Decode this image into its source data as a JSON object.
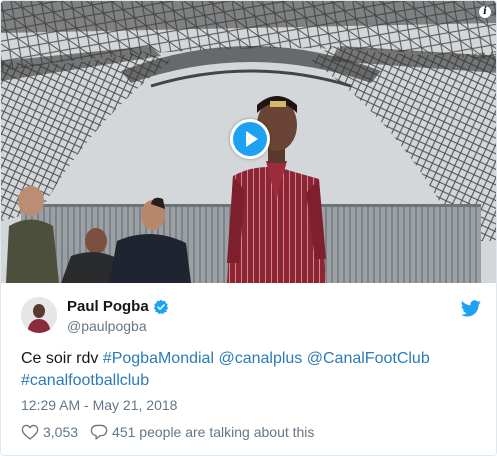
{
  "media": {
    "info_glyph": "i",
    "play_icon": "play-icon",
    "accent_color": "#1da1f2"
  },
  "author": {
    "display_name": "Paul Pogba",
    "handle": "@paulpogba",
    "verified_icon": "verified-badge-icon",
    "platform_icon": "twitter-bird-icon"
  },
  "tweet": {
    "text_parts": [
      {
        "type": "text",
        "value": "Ce soir rdv "
      },
      {
        "type": "link",
        "value": "#PogbaMondial"
      },
      {
        "type": "text",
        "value": " "
      },
      {
        "type": "link",
        "value": "@canalplus"
      },
      {
        "type": "text",
        "value": " "
      },
      {
        "type": "link",
        "value": "@CanalFootClub"
      },
      {
        "type": "text",
        "value": " "
      },
      {
        "type": "link",
        "value": "#canalfootballclub"
      }
    ],
    "timestamp": "12:29 AM - May 21, 2018",
    "link_color": "#2b7bb9"
  },
  "actions": {
    "likes": "3,053",
    "talking": "451 people are talking about this",
    "like_icon": "heart-icon",
    "reply_icon": "speech-bubble-icon"
  }
}
